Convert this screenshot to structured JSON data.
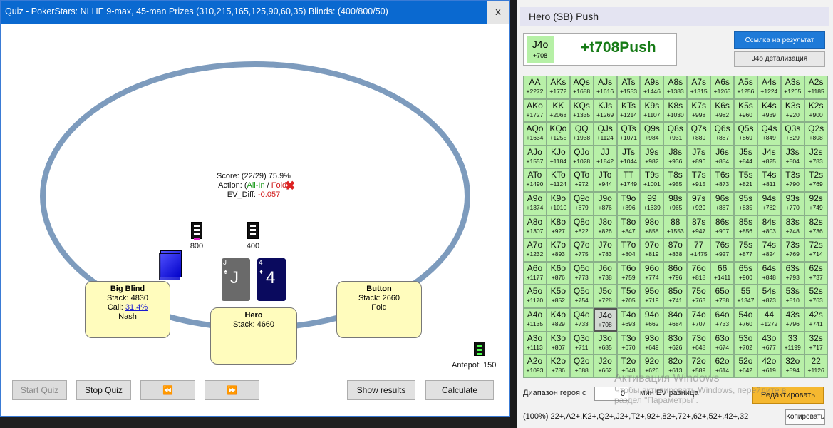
{
  "quiz": {
    "title": "Quiz - PokerStars: NLHE 9-max, 45-man Prizes (310,215,165,125,90,60,35) Blinds: (400/800/50)",
    "close_glyph": "x",
    "score": "Score: (22/29) 75.9%",
    "action_prefix": "Action: (",
    "action_allin": "All-In",
    "action_sep": " / ",
    "action_fold": "Fold",
    "action_suffix": ")",
    "ev_label": "EV_Diff: ",
    "ev_value": "-0.057",
    "bet_bb": "800",
    "bet_sb": "400",
    "big_blind": {
      "name": "Big Blind",
      "stack": "Stack: 4830",
      "call_prefix": "Call: ",
      "call_pct": "31.4%",
      "strategy": "Nash"
    },
    "hero": {
      "name": "Hero",
      "stack": "Stack: 4660"
    },
    "button": {
      "name": "Button",
      "stack": "Stack: 2660",
      "action": "Fold"
    },
    "cards": [
      {
        "rank": "J",
        "suit": "♠",
        "color": "#6a6a6a"
      },
      {
        "rank": "4",
        "suit": "♦",
        "color": "#0a0a5e"
      }
    ],
    "antepot": "Antepot: 150",
    "buttons": {
      "start": "Start Quiz",
      "stop": "Stop Quiz",
      "prev": "⏪",
      "next": "⏩",
      "show": "Show results",
      "calc": "Calculate"
    }
  },
  "panel": {
    "header": "Hero (SB) Push",
    "hand": "J4o",
    "hand_ev": "+708",
    "result": "+t708Push",
    "link_btn": "Ссылка на результат",
    "detail_btn": "J4o детализация",
    "range_label": "Диапазон героя с",
    "range_value": "0",
    "range_label2": "мин EV разница",
    "edit_btn": "Редактировать",
    "range_string": "(100%) 22+,A2+,K2+,Q2+,J2+,T2+,92+,82+,72+,62+,52+,42+,32",
    "copy_btn": "Копировать",
    "watermark_title": "Активация Windows",
    "watermark_line1": "Чтобы активировать Windows, перейдите в",
    "watermark_line2": "раздел \"Параметры\".",
    "selected_hand": "J4o",
    "grid": [
      [
        [
          "AA",
          "+2272"
        ],
        [
          "AKs",
          "+1772"
        ],
        [
          "AQs",
          "+1688"
        ],
        [
          "AJs",
          "+1616"
        ],
        [
          "ATs",
          "+1553"
        ],
        [
          "A9s",
          "+1446"
        ],
        [
          "A8s",
          "+1383"
        ],
        [
          "A7s",
          "+1315"
        ],
        [
          "A6s",
          "+1263"
        ],
        [
          "A5s",
          "+1256"
        ],
        [
          "A4s",
          "+1224"
        ],
        [
          "A3s",
          "+1205"
        ],
        [
          "A2s",
          "+1185"
        ]
      ],
      [
        [
          "AKo",
          "+1727"
        ],
        [
          "KK",
          "+2068"
        ],
        [
          "KQs",
          "+1335"
        ],
        [
          "KJs",
          "+1269"
        ],
        [
          "KTs",
          "+1214"
        ],
        [
          "K9s",
          "+1107"
        ],
        [
          "K8s",
          "+1030"
        ],
        [
          "K7s",
          "+998"
        ],
        [
          "K6s",
          "+982"
        ],
        [
          "K5s",
          "+960"
        ],
        [
          "K4s",
          "+939"
        ],
        [
          "K3s",
          "+920"
        ],
        [
          "K2s",
          "+900"
        ]
      ],
      [
        [
          "AQo",
          "+1634"
        ],
        [
          "KQo",
          "+1255"
        ],
        [
          "QQ",
          "+1938"
        ],
        [
          "QJs",
          "+1124"
        ],
        [
          "QTs",
          "+1071"
        ],
        [
          "Q9s",
          "+984"
        ],
        [
          "Q8s",
          "+931"
        ],
        [
          "Q7s",
          "+889"
        ],
        [
          "Q6s",
          "+887"
        ],
        [
          "Q5s",
          "+869"
        ],
        [
          "Q4s",
          "+849"
        ],
        [
          "Q3s",
          "+829"
        ],
        [
          "Q2s",
          "+808"
        ]
      ],
      [
        [
          "AJo",
          "+1557"
        ],
        [
          "KJo",
          "+1184"
        ],
        [
          "QJo",
          "+1028"
        ],
        [
          "JJ",
          "+1842"
        ],
        [
          "JTs",
          "+1044"
        ],
        [
          "J9s",
          "+982"
        ],
        [
          "J8s",
          "+936"
        ],
        [
          "J7s",
          "+896"
        ],
        [
          "J6s",
          "+854"
        ],
        [
          "J5s",
          "+844"
        ],
        [
          "J4s",
          "+825"
        ],
        [
          "J3s",
          "+804"
        ],
        [
          "J2s",
          "+783"
        ]
      ],
      [
        [
          "ATo",
          "+1490"
        ],
        [
          "KTo",
          "+1124"
        ],
        [
          "QTo",
          "+972"
        ],
        [
          "JTo",
          "+944"
        ],
        [
          "TT",
          "+1749"
        ],
        [
          "T9s",
          "+1001"
        ],
        [
          "T8s",
          "+955"
        ],
        [
          "T7s",
          "+915"
        ],
        [
          "T6s",
          "+873"
        ],
        [
          "T5s",
          "+821"
        ],
        [
          "T4s",
          "+811"
        ],
        [
          "T3s",
          "+790"
        ],
        [
          "T2s",
          "+769"
        ]
      ],
      [
        [
          "A9o",
          "+1374"
        ],
        [
          "K9o",
          "+1010"
        ],
        [
          "Q9o",
          "+879"
        ],
        [
          "J9o",
          "+876"
        ],
        [
          "T9o",
          "+896"
        ],
        [
          "99",
          "+1639"
        ],
        [
          "98s",
          "+965"
        ],
        [
          "97s",
          "+929"
        ],
        [
          "96s",
          "+887"
        ],
        [
          "95s",
          "+835"
        ],
        [
          "94s",
          "+782"
        ],
        [
          "93s",
          "+770"
        ],
        [
          "92s",
          "+749"
        ]
      ],
      [
        [
          "A8o",
          "+1307"
        ],
        [
          "K8o",
          "+927"
        ],
        [
          "Q8o",
          "+822"
        ],
        [
          "J8o",
          "+826"
        ],
        [
          "T8o",
          "+847"
        ],
        [
          "98o",
          "+858"
        ],
        [
          "88",
          "+1553"
        ],
        [
          "87s",
          "+947"
        ],
        [
          "86s",
          "+907"
        ],
        [
          "85s",
          "+856"
        ],
        [
          "84s",
          "+803"
        ],
        [
          "83s",
          "+748"
        ],
        [
          "82s",
          "+736"
        ]
      ],
      [
        [
          "A7o",
          "+1232"
        ],
        [
          "K7o",
          "+893"
        ],
        [
          "Q7o",
          "+775"
        ],
        [
          "J7o",
          "+783"
        ],
        [
          "T7o",
          "+804"
        ],
        [
          "97o",
          "+819"
        ],
        [
          "87o",
          "+838"
        ],
        [
          "77",
          "+1475"
        ],
        [
          "76s",
          "+927"
        ],
        [
          "75s",
          "+877"
        ],
        [
          "74s",
          "+824"
        ],
        [
          "73s",
          "+769"
        ],
        [
          "72s",
          "+714"
        ]
      ],
      [
        [
          "A6o",
          "+1177"
        ],
        [
          "K6o",
          "+876"
        ],
        [
          "Q6o",
          "+773"
        ],
        [
          "J6o",
          "+738"
        ],
        [
          "T6o",
          "+759"
        ],
        [
          "96o",
          "+774"
        ],
        [
          "86o",
          "+796"
        ],
        [
          "76o",
          "+818"
        ],
        [
          "66",
          "+1411"
        ],
        [
          "65s",
          "+900"
        ],
        [
          "64s",
          "+848"
        ],
        [
          "63s",
          "+793"
        ],
        [
          "62s",
          "+737"
        ]
      ],
      [
        [
          "A5o",
          "+1170"
        ],
        [
          "K5o",
          "+852"
        ],
        [
          "Q5o",
          "+754"
        ],
        [
          "J5o",
          "+728"
        ],
        [
          "T5o",
          "+705"
        ],
        [
          "95o",
          "+719"
        ],
        [
          "85o",
          "+741"
        ],
        [
          "75o",
          "+763"
        ],
        [
          "65o",
          "+788"
        ],
        [
          "55",
          "+1347"
        ],
        [
          "54s",
          "+873"
        ],
        [
          "53s",
          "+810"
        ],
        [
          "52s",
          "+763"
        ]
      ],
      [
        [
          "A4o",
          "+1135"
        ],
        [
          "K4o",
          "+829"
        ],
        [
          "Q4o",
          "+733"
        ],
        [
          "J4o",
          "+708"
        ],
        [
          "T4o",
          "+693"
        ],
        [
          "94o",
          "+662"
        ],
        [
          "84o",
          "+684"
        ],
        [
          "74o",
          "+707"
        ],
        [
          "64o",
          "+733"
        ],
        [
          "54o",
          "+760"
        ],
        [
          "44",
          "+1272"
        ],
        [
          "43s",
          "+796"
        ],
        [
          "42s",
          "+741"
        ]
      ],
      [
        [
          "A3o",
          "+1113"
        ],
        [
          "K3o",
          "+807"
        ],
        [
          "Q3o",
          "+711"
        ],
        [
          "J3o",
          "+685"
        ],
        [
          "T3o",
          "+670"
        ],
        [
          "93o",
          "+649"
        ],
        [
          "83o",
          "+626"
        ],
        [
          "73o",
          "+648"
        ],
        [
          "63o",
          "+674"
        ],
        [
          "53o",
          "+702"
        ],
        [
          "43o",
          "+677"
        ],
        [
          "33",
          "+1199"
        ],
        [
          "32s",
          "+717"
        ]
      ],
      [
        [
          "A2o",
          "+1093"
        ],
        [
          "K2o",
          "+786"
        ],
        [
          "Q2o",
          "+688"
        ],
        [
          "J2o",
          "+662"
        ],
        [
          "T2o",
          "+648"
        ],
        [
          "92o",
          "+626"
        ],
        [
          "82o",
          "+613"
        ],
        [
          "72o",
          "+589"
        ],
        [
          "62o",
          "+614"
        ],
        [
          "52o",
          "+642"
        ],
        [
          "42o",
          "+619"
        ],
        [
          "32o",
          "+594"
        ],
        [
          "22",
          "+1126"
        ]
      ]
    ]
  }
}
